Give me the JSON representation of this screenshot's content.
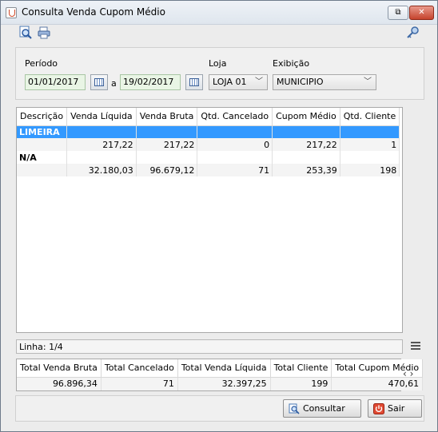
{
  "window": {
    "title": "Consulta Venda Cupom Médio",
    "restore": "⧉",
    "close": "✕"
  },
  "toolbar": {
    "search_icon": "magnifier-document-icon",
    "print_icon": "printer-icon",
    "key_icon": "key-icon"
  },
  "filters": {
    "periodo_label": "Período",
    "date_from": "01/01/2017",
    "sep": "a",
    "date_to": "19/02/2017",
    "loja_label": "Loja",
    "loja_value": "LOJA 01",
    "exibicao_label": "Exibição",
    "exibicao_value": "MUNICIPIO"
  },
  "grid": {
    "columns": [
      "Descrição",
      "Venda Líquida",
      "Venda Bruta",
      "Qtd. Cancelado",
      "Cupom Médio",
      "Qtd. Cliente"
    ],
    "groups": [
      {
        "name": "LIMEIRA",
        "values": [
          "",
          "217,22",
          "217,22",
          "0",
          "217,22",
          "1"
        ]
      },
      {
        "name": "N/A",
        "values": [
          "",
          "32.180,03",
          "96.679,12",
          "71",
          "253,39",
          "198"
        ]
      }
    ]
  },
  "status": {
    "linha": "Linha: 1/4"
  },
  "totals": {
    "columns": [
      "Total Venda Bruta",
      "Total Cancelado",
      "Total Venda Líquida",
      "Total Cliente",
      "Total Cupom Médio"
    ],
    "values": [
      "96.896,34",
      "71",
      "32.397,25",
      "199",
      "470,61"
    ]
  },
  "buttons": {
    "consultar": "Consultar",
    "sair": "Sair"
  },
  "colors": {
    "selection": "#3399ff",
    "input_bg": "#e9f5e5"
  }
}
